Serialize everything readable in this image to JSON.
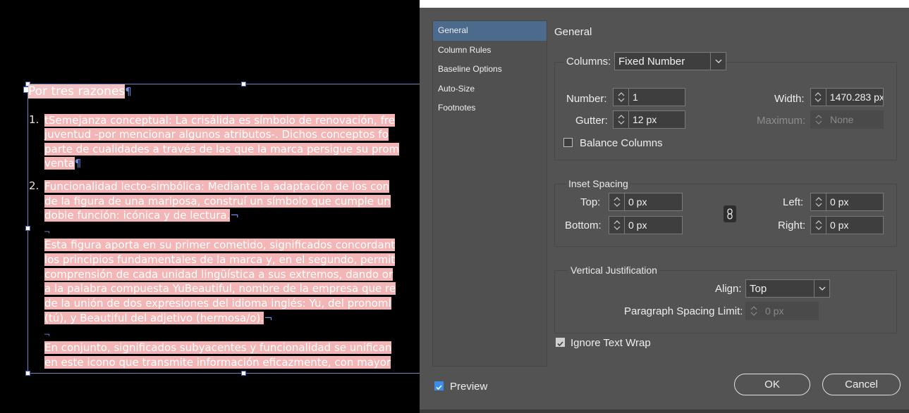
{
  "document": {
    "title": "Por tres razones",
    "paragraphs": [
      {
        "number": "1.",
        "lines": [
          "tSemejanza conceptual: La crisálida es símbolo de renovación, fre",
          "juventud -por mencionar algunos atributos-. Dichos conceptos fo",
          "parte de cualidades a través de las que la marca persigue su prom",
          "venta"
        ]
      },
      {
        "number": "2.",
        "lines": [
          "Funcionalidad lecto-simbólica: Mediante la adaptación de los con",
          "de la figura de una mariposa, construí un símbolo que cumple un",
          "doble función: icónica y de lectura."
        ]
      },
      {
        "number": "",
        "lines": [
          "Esta figura aporta en su primer cometido, significados concordant",
          "los principios fundamentales de la marca y, en el segundo, permit",
          "comprensión de cada unidad lingüística a sus extremos, dando or",
          "a la palabra compuesta YuBeautiful, nombre de la empresa que re",
          "de la unión de dos expresiones del idioma inglés: Yu, del pronoml",
          "(tú), y Beautiful del adjetivo (hermosa/o)."
        ]
      },
      {
        "number": "",
        "lines": [
          "En conjunto, significados subyacentes y funcionalidad se unifican",
          "en este icono que transmite información eficazmente, con mayor"
        ]
      }
    ]
  },
  "dialog": {
    "nav": [
      "General",
      "Column Rules",
      "Baseline Options",
      "Auto-Size",
      "Footnotes"
    ],
    "active_nav": "General",
    "panel_title": "General",
    "columns": {
      "label": "Columns:",
      "type": "Fixed Number",
      "number_label": "Number:",
      "number": "1",
      "gutter_label": "Gutter:",
      "gutter": "12 px",
      "width_label": "Width:",
      "width": "1470.283 px",
      "maximum_label": "Maximum:",
      "maximum": "None",
      "balance_label": "Balance Columns",
      "balance_checked": false
    },
    "inset": {
      "label": "Inset Spacing",
      "top_label": "Top:",
      "top": "0 px",
      "bottom_label": "Bottom:",
      "bottom": "0 px",
      "left_label": "Left:",
      "left": "0 px",
      "right_label": "Right:",
      "right": "0 px",
      "link_icon": "chain-link-icon"
    },
    "vertical": {
      "label": "Vertical Justification",
      "align_label": "Align:",
      "align": "Top",
      "psl_label": "Paragraph Spacing Limit:",
      "psl": "0 px"
    },
    "ignore_text_wrap_label": "Ignore Text Wrap",
    "ignore_text_wrap_checked": true,
    "preview_label": "Preview",
    "preview_checked": true,
    "ok_label": "OK",
    "cancel_label": "Cancel"
  },
  "colors": {
    "dialog_bg": "#535353",
    "nav_selected": "#4b6a8c",
    "text_highlight": "#f3b5b5",
    "frame_border": "#6b86c9",
    "preview_check": "#3b8ee8"
  }
}
